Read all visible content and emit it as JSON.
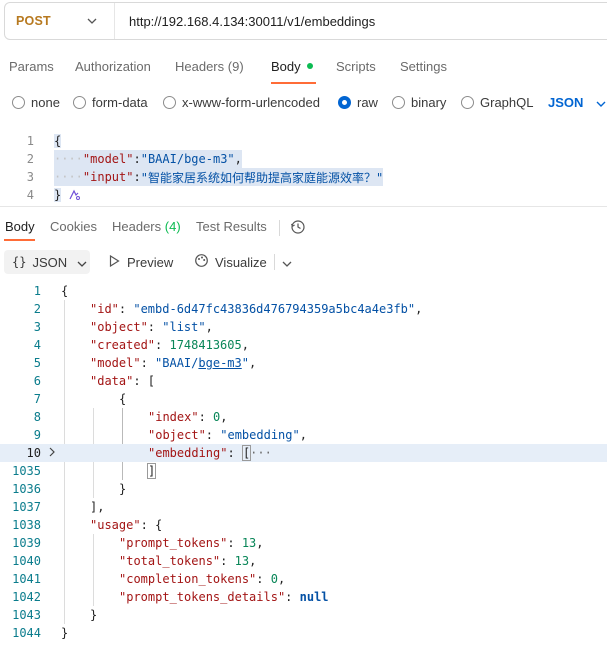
{
  "request": {
    "method": "POST",
    "url": "http://192.168.4.134:30011/v1/embeddings"
  },
  "request_tabs": {
    "params": "Params",
    "authorization": "Authorization",
    "headers": "Headers",
    "headers_count": "(9)",
    "body": "Body",
    "scripts": "Scripts",
    "settings": "Settings"
  },
  "body_options": {
    "none": "none",
    "form_data": "form-data",
    "urlencoded": "x-www-form-urlencoded",
    "raw": "raw",
    "binary": "binary",
    "graphql": "GraphQL",
    "format": "JSON"
  },
  "request_body": {
    "line_numbers": [
      "1",
      "2",
      "3",
      "4"
    ],
    "open_brace": "{",
    "close_brace": "}",
    "model_key": "\"model\"",
    "model_value": "\"BAAI/bge-m3\"",
    "input_key": "\"input\"",
    "input_value": "\"智能家居系统如何帮助提高家庭能源效率？\""
  },
  "response_tabs": {
    "body": "Body",
    "cookies": "Cookies",
    "headers": "Headers",
    "headers_count": "(4)",
    "test_results": "Test Results"
  },
  "response_toolbar": {
    "format": "JSON",
    "preview": "Preview",
    "visualize": "Visualize"
  },
  "response_body": {
    "line_numbers": [
      "1",
      "2",
      "3",
      "4",
      "5",
      "6",
      "7",
      "8",
      "9",
      "10",
      "1035",
      "1036",
      "1037",
      "1038",
      "1039",
      "1040",
      "1041",
      "1042",
      "1043",
      "1044"
    ],
    "id_key": "\"id\"",
    "id_value": "\"embd-6d47fc43836d476794359a5bc4a4e3fb\"",
    "object_key": "\"object\"",
    "object_value": "\"list\"",
    "created_key": "\"created\"",
    "created_value": "1748413605",
    "model_key": "\"model\"",
    "model_value_a": "\"BAAI/",
    "model_value_b": "bge-m3",
    "model_value_c": "\"",
    "data_key": "\"data\"",
    "index_key": "\"index\"",
    "index_value": "0",
    "item_object_key": "\"object\"",
    "item_object_value": "\"embedding\"",
    "embedding_key": "\"embedding\"",
    "embedding_collapsed": "···",
    "usage_key": "\"usage\"",
    "prompt_tokens_key": "\"prompt_tokens\"",
    "prompt_tokens_value": "13",
    "total_tokens_key": "\"total_tokens\"",
    "total_tokens_value": "13",
    "completion_tokens_key": "\"completion_tokens\"",
    "completion_tokens_value": "0",
    "prompt_tokens_details_key": "\"prompt_tokens_details\"",
    "prompt_tokens_details_value": "null"
  }
}
